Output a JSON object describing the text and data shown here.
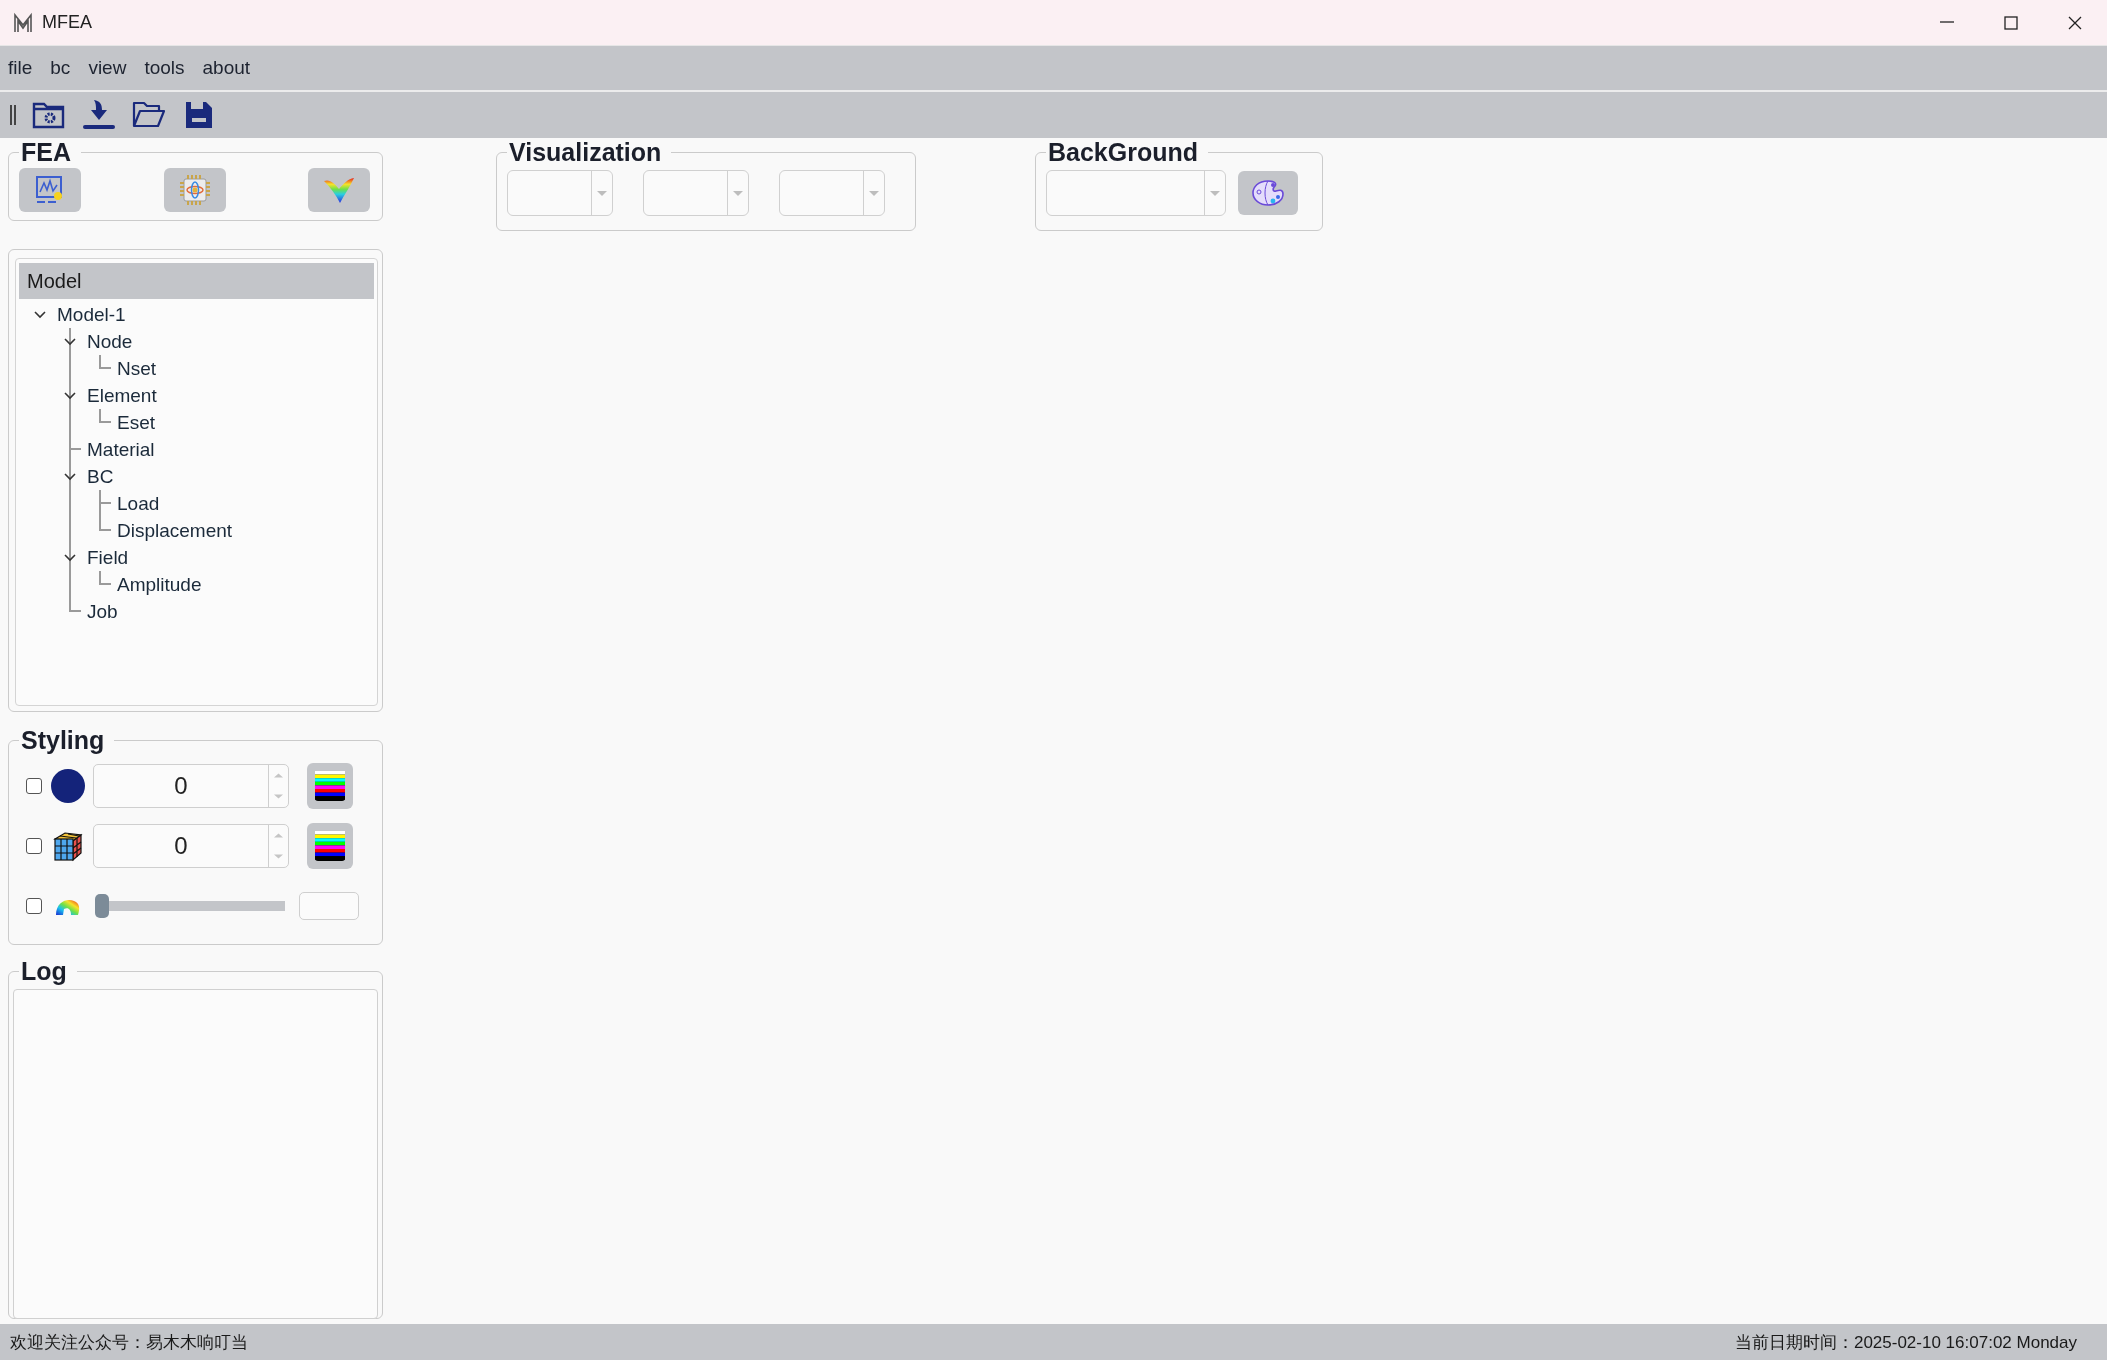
{
  "window": {
    "title": "MFEA"
  },
  "menu": [
    "file",
    "bc",
    "view",
    "tools",
    "about"
  ],
  "fea": {
    "title": "FEA"
  },
  "visualization": {
    "title": "Visualization"
  },
  "background": {
    "title": "BackGround"
  },
  "tree": {
    "header": "Model",
    "items": [
      {
        "label": "Model-1",
        "expanded": true,
        "children": [
          {
            "label": "Node",
            "expanded": true,
            "children": [
              {
                "label": "Nset"
              }
            ]
          },
          {
            "label": "Element",
            "expanded": true,
            "children": [
              {
                "label": "Eset"
              }
            ]
          },
          {
            "label": "Material"
          },
          {
            "label": "BC",
            "expanded": true,
            "children": [
              {
                "label": "Load"
              },
              {
                "label": "Displacement"
              }
            ]
          },
          {
            "label": "Field",
            "expanded": true,
            "children": [
              {
                "label": "Amplitude"
              }
            ]
          },
          {
            "label": "Job"
          }
        ]
      }
    ]
  },
  "styling": {
    "title": "Styling",
    "rows": [
      {
        "kind": "points",
        "checked": false,
        "value": "0"
      },
      {
        "kind": "mesh",
        "checked": false,
        "value": "0"
      },
      {
        "kind": "contour",
        "checked": false,
        "level": 0
      }
    ]
  },
  "log": {
    "title": "Log"
  },
  "status_bar": {
    "left": "欢迎关注公众号：易木木响叮当",
    "right": "当前日期时间：2025-02-10 16:07:02 Monday"
  }
}
